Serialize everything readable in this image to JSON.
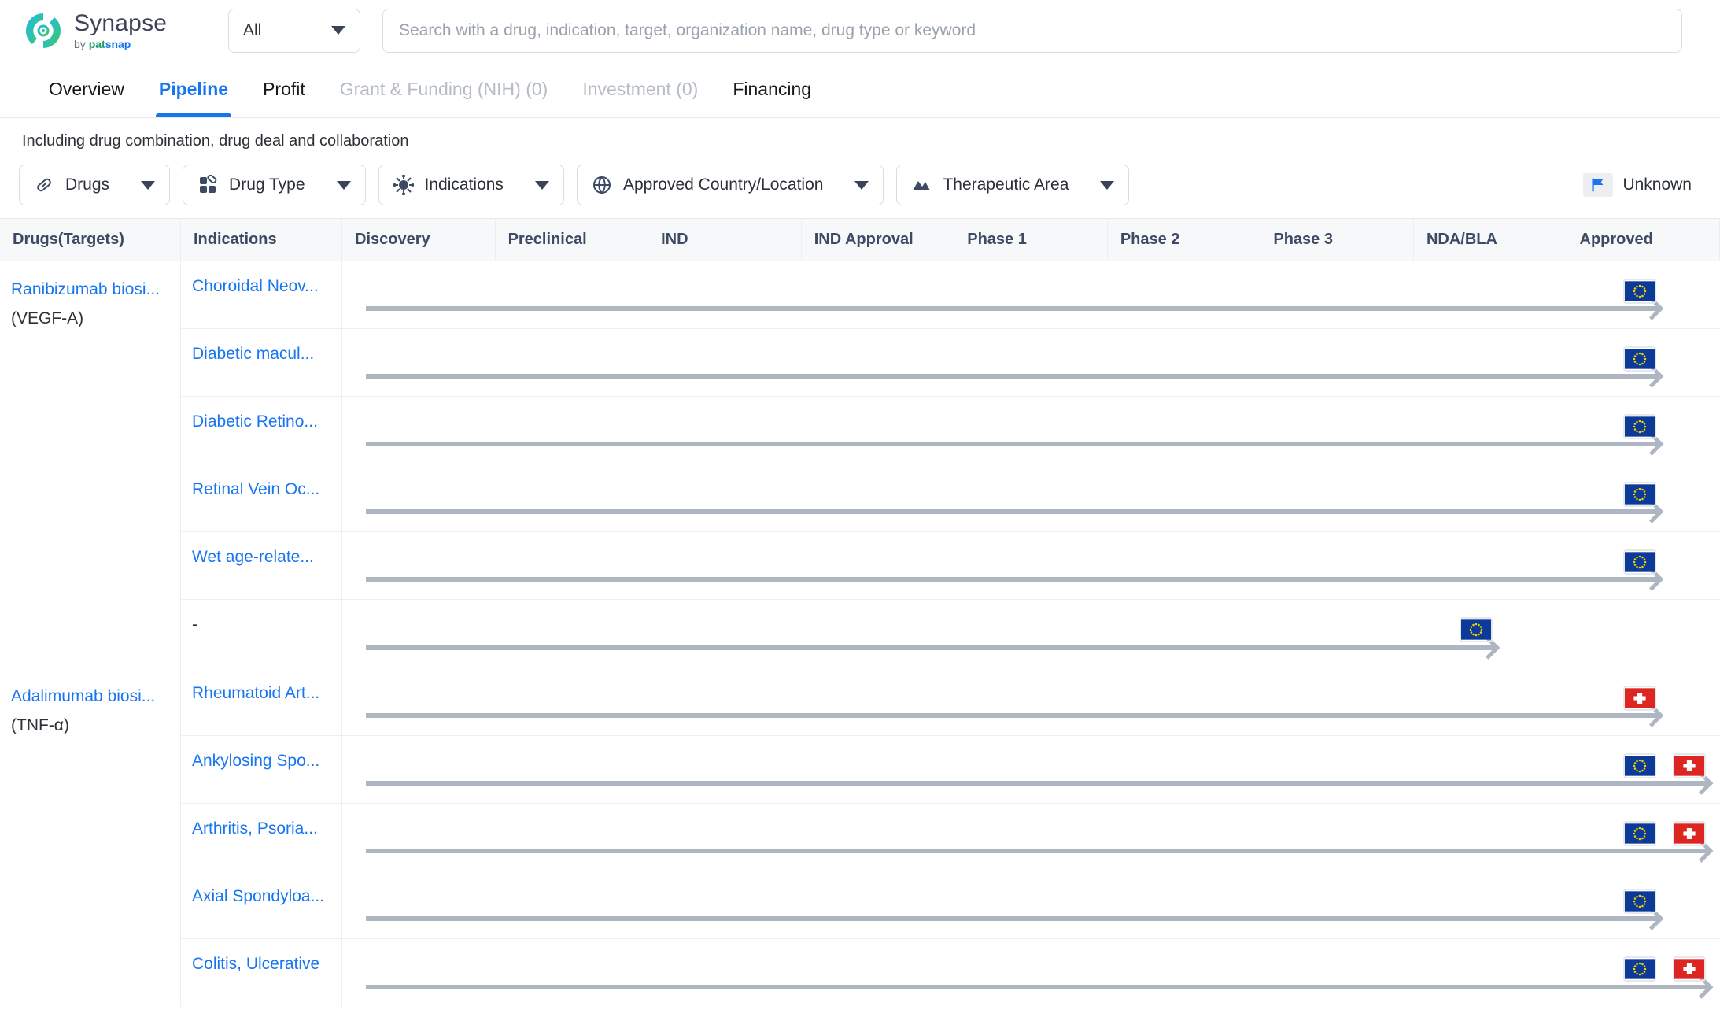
{
  "brand": {
    "name": "Synapse",
    "by": "by ",
    "pat": "pat",
    "snap": "snap",
    "logo_icon": "synapse-swirl-logo"
  },
  "search": {
    "scope_value": "All",
    "placeholder": "Search with a drug, indication, target, organization name, drug type or keyword",
    "value": ""
  },
  "tabs": [
    {
      "label": "Overview",
      "state": "normal"
    },
    {
      "label": "Pipeline",
      "state": "active"
    },
    {
      "label": "Profit",
      "state": "normal"
    },
    {
      "label": "Grant & Funding (NIH) (0)",
      "state": "disabled"
    },
    {
      "label": "Investment (0)",
      "state": "disabled"
    },
    {
      "label": "Financing",
      "state": "normal"
    }
  ],
  "subnote": "Including drug combination, drug deal and collaboration",
  "filters": [
    {
      "label": "Drugs",
      "icon": "capsule-icon"
    },
    {
      "label": "Drug Type",
      "icon": "pills-icon"
    },
    {
      "label": "Indications",
      "icon": "virus-icon"
    },
    {
      "label": "Approved Country/Location",
      "icon": "globe-icon"
    },
    {
      "label": "Therapeutic Area",
      "icon": "mountain-icon"
    }
  ],
  "legend": {
    "label": "Unknown",
    "icon": "blue-flag-icon",
    "color": "#1875f0"
  },
  "table": {
    "columns": [
      "Drugs(Targets)",
      "Indications",
      "Discovery",
      "Preclinical",
      "IND",
      "IND Approval",
      "Phase 1",
      "Phase 2",
      "Phase 3",
      "NDA/BLA",
      "Approved"
    ],
    "groups": [
      {
        "drug": "Ranibizumab biosi...",
        "target": "(VEGF-A)",
        "rows": [
          {
            "indication": "Choroidal Neov...",
            "flags": [
              {
                "country": "EU",
                "stage": "Approved"
              }
            ]
          },
          {
            "indication": "Diabetic macul...",
            "flags": [
              {
                "country": "EU",
                "stage": "Approved"
              }
            ]
          },
          {
            "indication": "Diabetic Retino...",
            "flags": [
              {
                "country": "EU",
                "stage": "Approved"
              }
            ]
          },
          {
            "indication": "Retinal Vein Oc...",
            "flags": [
              {
                "country": "EU",
                "stage": "Approved"
              }
            ]
          },
          {
            "indication": "Wet age-relate...",
            "flags": [
              {
                "country": "EU",
                "stage": "Approved"
              }
            ]
          },
          {
            "indication": "-",
            "flags": [
              {
                "country": "EU",
                "stage": "NDA/BLA"
              }
            ]
          }
        ]
      },
      {
        "drug": "Adalimumab biosi...",
        "target": "(TNF-α)",
        "rows": [
          {
            "indication": "Rheumatoid Art...",
            "flags": [
              {
                "country": "CH",
                "stage": "Approved"
              }
            ]
          },
          {
            "indication": "Ankylosing Spo...",
            "flags": [
              {
                "country": "EU",
                "stage": "Approved"
              },
              {
                "country": "CH",
                "stage": "Approved2"
              }
            ]
          },
          {
            "indication": "Arthritis, Psoria...",
            "flags": [
              {
                "country": "EU",
                "stage": "Approved"
              },
              {
                "country": "CH",
                "stage": "Approved2"
              }
            ]
          },
          {
            "indication": "Axial Spondyloa...",
            "flags": [
              {
                "country": "EU",
                "stage": "Approved"
              }
            ]
          },
          {
            "indication": "Colitis, Ulcerative",
            "flags": [
              {
                "country": "EU",
                "stage": "Approved"
              },
              {
                "country": "CH",
                "stage": "Approved2"
              }
            ]
          }
        ]
      }
    ]
  }
}
